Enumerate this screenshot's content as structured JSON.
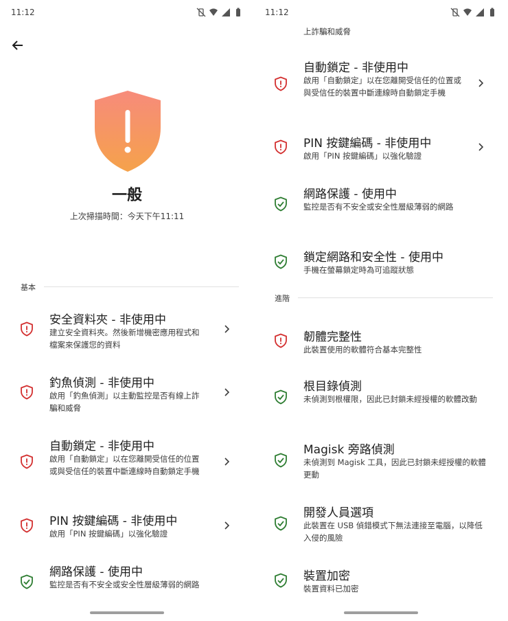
{
  "status": {
    "time": "11:12"
  },
  "header": {
    "title": "一般",
    "scan_time": "上次掃描時間：今天下午11:11"
  },
  "colors": {
    "warning": "#d32f2f",
    "ok": "#2e7d32",
    "shield_top": "#f78b7b",
    "shield_bottom": "#f5a24b"
  },
  "sections": {
    "basic": "基本",
    "advanced": "進階"
  },
  "left_items": [
    {
      "title": "安全資料夾 - 非使用中",
      "desc": "建立安全資料夾。然後新增機密應用程式和檔案來保護您的資料",
      "status": "warning",
      "chevron": true
    },
    {
      "title": "釣魚偵測 - 非使用中",
      "desc": "啟用「釣魚偵測」以主動監控是否有線上詐騙和威脅",
      "status": "warning",
      "chevron": true
    },
    {
      "title": "自動鎖定 - 非使用中",
      "desc": "啟用「自動鎖定」以在您離開受信任的位置或與受信任的裝置中斷連線時自動鎖定手機",
      "status": "warning",
      "chevron": true
    },
    {
      "title": "PIN 按鍵編碼 - 非使用中",
      "desc": "啟用「PIN 按鍵編碼」以強化驗證",
      "status": "warning",
      "chevron": true
    },
    {
      "title": "網路保護 - 使用中",
      "desc": "監控是否有不安全或安全性層級薄弱的網路",
      "status": "ok",
      "chevron": false
    }
  ],
  "right_partial": "上詐騙和威脅",
  "right_items": [
    {
      "title": "自動鎖定 - 非使用中",
      "desc": "啟用「自動鎖定」以在您離開受信任的位置或與受信任的裝置中斷連線時自動鎖定手機",
      "status": "warning",
      "chevron": true
    },
    {
      "title": "PIN 按鍵編碼 - 非使用中",
      "desc": "啟用「PIN 按鍵編碼」以強化驗證",
      "status": "warning",
      "chevron": true
    },
    {
      "title": "網路保護 - 使用中",
      "desc": "監控是否有不安全或安全性層級薄弱的網路",
      "status": "ok",
      "chevron": false
    },
    {
      "title": "鎖定網路和安全性 - 使用中",
      "desc": "手機在螢幕鎖定時為可追蹤狀態",
      "status": "ok",
      "chevron": false
    }
  ],
  "advanced_items": [
    {
      "title": "韌體完整性",
      "desc": "此裝置使用的軟體符合基本完整性",
      "status": "warning",
      "chevron": false
    },
    {
      "title": "根目錄偵測",
      "desc": "未偵測到根權限，因此已封鎖未經授權的軟體改動",
      "status": "ok",
      "chevron": false
    },
    {
      "title": "Magisk 旁路偵測",
      "desc": "未偵測到 Magisk 工具，因此已封鎖未經授權的軟體更動",
      "status": "ok",
      "chevron": false
    },
    {
      "title": "開發人員選項",
      "desc": "此裝置在 USB 偵錯模式下無法連接至電腦，以降低入侵的風險",
      "status": "ok",
      "chevron": false
    },
    {
      "title": "裝置加密",
      "desc": "裝置資料已加密",
      "status": "ok",
      "chevron": false
    }
  ]
}
